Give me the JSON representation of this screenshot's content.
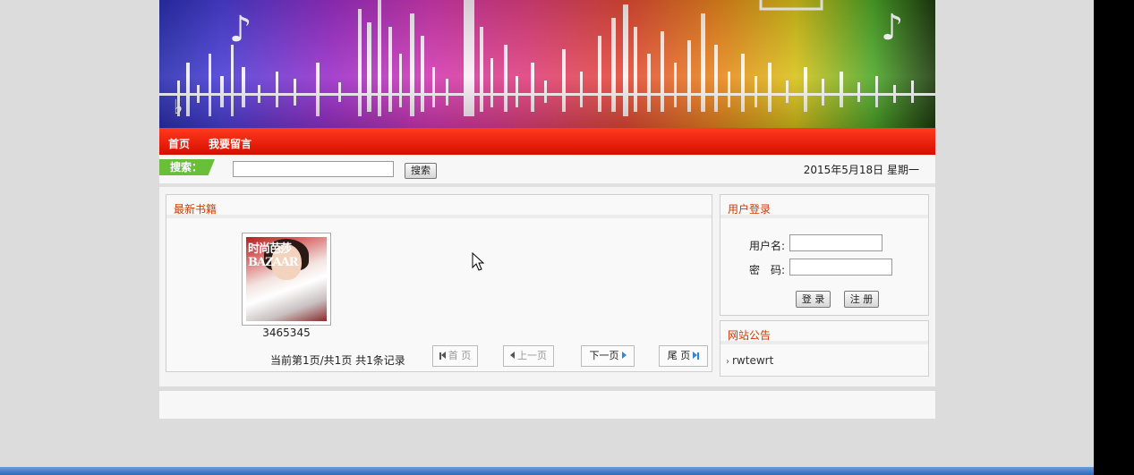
{
  "nav": {
    "home": "首页",
    "guestbook": "我要留言"
  },
  "search": {
    "label": "搜索：",
    "input_value": "",
    "button": "搜索"
  },
  "date_text": "2015年5月18日 星期一",
  "books_panel": {
    "title": "最新书籍",
    "books": [
      {
        "name": "3465345",
        "cover_text": "时尚芭莎 BAZAAR"
      }
    ],
    "pager": {
      "status": "当前第1页/共1页  共1条记录",
      "first": "首 页",
      "prev": "上一页",
      "next": "下一页",
      "last": "尾 页"
    }
  },
  "login_panel": {
    "title": "用户登录",
    "username_label": "用户名:",
    "password_label": "密　码:",
    "login_button": "登 录",
    "register_button": "注 册"
  },
  "notice_panel": {
    "title": "网站公告",
    "items": [
      "rwtewrt"
    ]
  },
  "colors": {
    "nav_red": "#e01a05",
    "accent_orange": "#d03a00",
    "search_green": "#6abf3a"
  }
}
